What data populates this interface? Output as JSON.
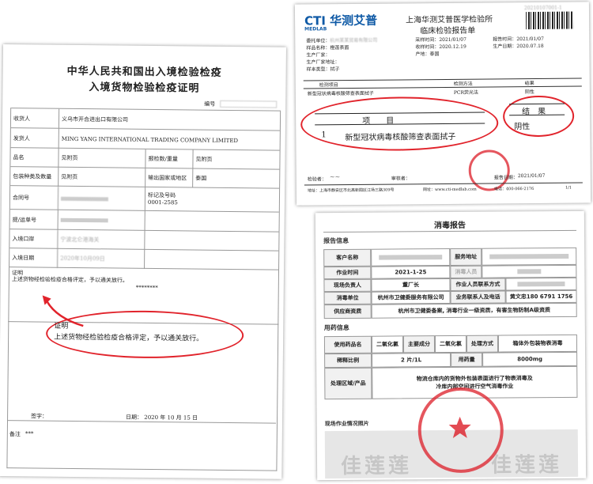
{
  "certificate": {
    "title_line1": "中华人民共和国出入境检验检疫",
    "title_line2": "入境货物检验检疫证明",
    "number_label": "编号",
    "rows": [
      {
        "label": "收货人",
        "value": "义乌市开合进出口有限公司"
      },
      {
        "label": "发货人",
        "value": "MING YANG INTERNATIONAL TRADING COMPANY LIMITED"
      },
      {
        "label": "品名",
        "value": "见附页",
        "label2": "报检数/重量",
        "value2": "见附页"
      },
      {
        "label": "包装种类及数量",
        "value": "见附页",
        "label2": "输出国家或地区",
        "value2": "泰国"
      },
      {
        "label": "合同号",
        "value": "",
        "label2": "标记及号码",
        "value2": "0001-2585"
      },
      {
        "label": "提/运单号",
        "value": ""
      },
      {
        "label": "入境口岸",
        "value": "宁波北仑港海关"
      },
      {
        "label": "入境日期",
        "value": "2020年10月09日"
      }
    ],
    "proof_header": "证明",
    "proof_text": "上述货物经检验检疫合格评定，予以通关放行。",
    "stars": "********",
    "callout_header": "证明",
    "callout_text": "上述货物经检验检疫合格评定，予以通关放行。",
    "sign_label": "签字：",
    "sign_date": "日期：   2020  年   10  月   15  日",
    "remark_label": "备注",
    "remark_value": "***"
  },
  "lab": {
    "logo_text": "CTI 华测艾普",
    "logo_sub": "MEDLAB",
    "title1": "上海华测艾普医学检验所",
    "title2": "临床检验报告单",
    "id": "20210107001-1",
    "fields": [
      {
        "label": "委托单位：",
        "value": "杭州某某贸易有限公司"
      },
      {
        "label": "样品名称：",
        "value": "橙莲表面"
      },
      {
        "label": "生产厂家：",
        "value": ""
      },
      {
        "label": "生产厂家地址：",
        "value": ""
      },
      {
        "label": "样本类型：",
        "value": "拭子"
      }
    ],
    "right_fields": [
      {
        "label": "采样时间：",
        "value": "2021/01/07"
      },
      {
        "label": "收样时间：",
        "value": "2020.12.19"
      },
      {
        "label": "产地：",
        "value": "泰国"
      }
    ],
    "far_right_fields": [
      {
        "label": "报告时间：",
        "value": "2021/01/07"
      },
      {
        "label": "生产日期：",
        "value": "2020.07.18"
      }
    ],
    "table_headers": [
      "检测项目",
      "检测方法",
      "结果"
    ],
    "row_item": "新型冠状病毒核酸筛查表面拭子",
    "row_method": "PCR荧光法",
    "row_result": "阴性",
    "callout_item_header": "项　　目",
    "callout_no": "1",
    "callout_item": "新型冠状病毒核酸筛查表面拭子",
    "callout_result_header": "结　果",
    "callout_result": "阴性",
    "footer_tester": "检验者：",
    "footer_reviewer": "审核者：",
    "footer_date_label": "报告日期：",
    "footer_date": "2021/01/07",
    "address": "地址：上海市静安区市北高新园区江场三路309号",
    "website": "网址：www.cti-medlab.com",
    "phone": "电话：400-066-2176",
    "page": "1/1"
  },
  "disinfection": {
    "title": "消毒报告",
    "report_section": "报告信息",
    "client_label": "客户名称",
    "client_value": "",
    "address_label": "服务地址",
    "address_value": "",
    "time_label": "作业时间",
    "time_value": "2021-1-25",
    "time_label2": "消毒人员",
    "time_value2": "",
    "lead_label": "现场负责人",
    "lead_value": "董厂长",
    "op_label": "作业人员联系方式",
    "op_value": "",
    "unit_label": "消毒单位",
    "unit_value": "杭州市卫健委服务有限公司",
    "contact_label": "业务联系人及电话",
    "contact_value": "黄文忠180 6791 1756",
    "supplier_label": "供应商资质",
    "supplier_value": "杭州市卫健委备案, 消毒行业一级资质，有害生物防制A级资质",
    "drug_section": "用药信息",
    "drug_headers": [
      "使用药品名",
      "二氧化氯",
      "主要成分",
      "二氧化氯",
      "处理方式",
      "箱体外包装物表消毒"
    ],
    "ratio_label": "稀释比例",
    "ratio_value": "2 片/1L",
    "dose_label": "用药量",
    "dose_value": "8000mg",
    "process_label": "处理区域/产品",
    "process_value1": "物流仓库内的货物外包装表面进行了物表消毒及",
    "process_value2": "冷库内部空间进行空气消毒作业",
    "photo_section": "现场作业情况照片",
    "watermark": "佳莲莲"
  }
}
